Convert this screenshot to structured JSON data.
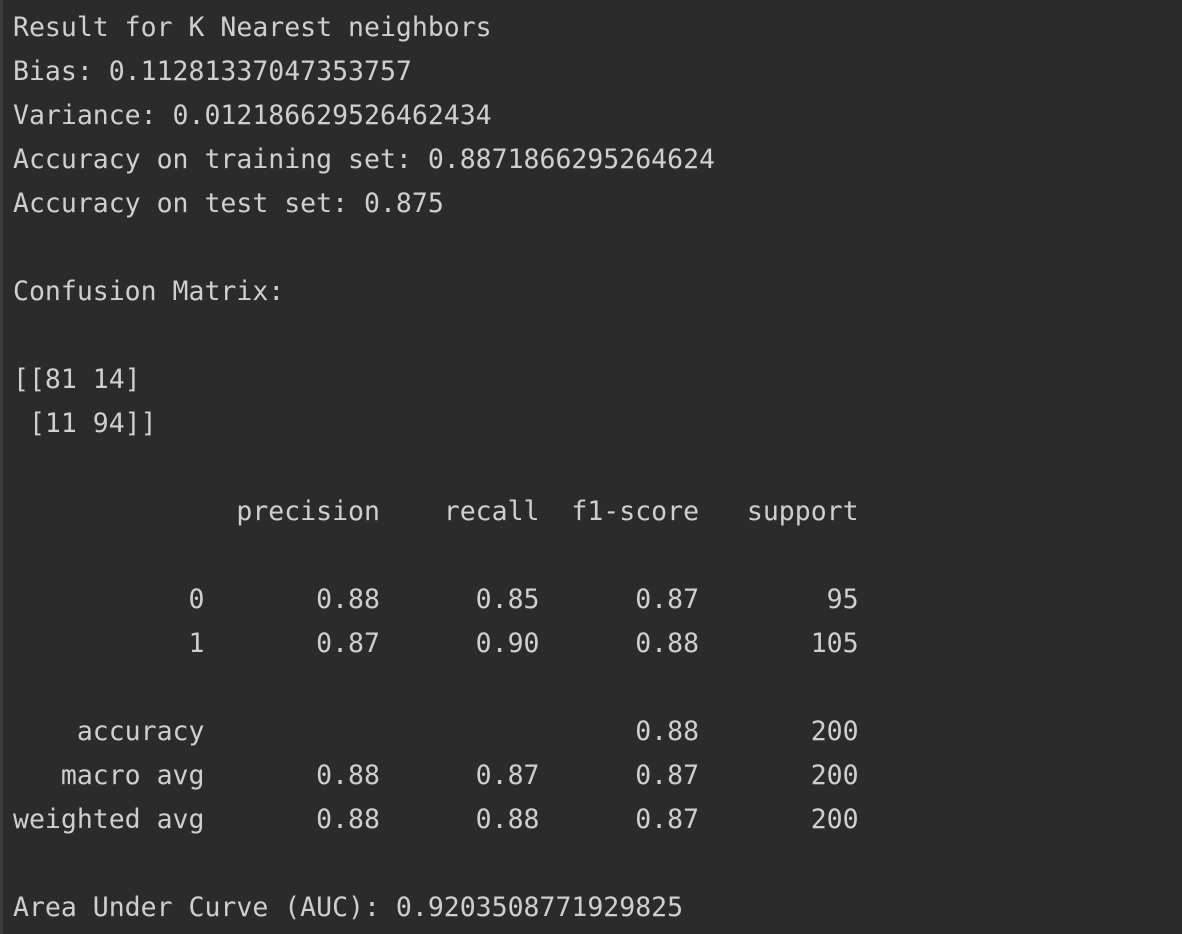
{
  "console": {
    "header": {
      "title": "Result for K Nearest neighbors",
      "bias": "Bias: 0.11281337047353757",
      "variance": "Variance: 0.012186629526462434",
      "train_accuracy": "Accuracy on training set: 0.8871866295264624",
      "test_accuracy": "Accuracy on test set: 0.875"
    },
    "confusion_matrix": {
      "label": "Confusion Matrix:",
      "row1": "[[81 14]",
      "row2": " [11 94]]"
    },
    "classification_report": {
      "header": "              precision    recall  f1-score   support",
      "row_0": "           0       0.88      0.85      0.87        95",
      "row_1": "           1       0.87      0.90      0.88       105",
      "accuracy": "    accuracy                           0.88       200",
      "macro_avg": "   macro avg       0.88      0.87      0.87       200",
      "weighted_avg": "weighted avg       0.88      0.88      0.87       200"
    },
    "auc": "Area Under Curve (AUC): 0.9203508771929825"
  }
}
